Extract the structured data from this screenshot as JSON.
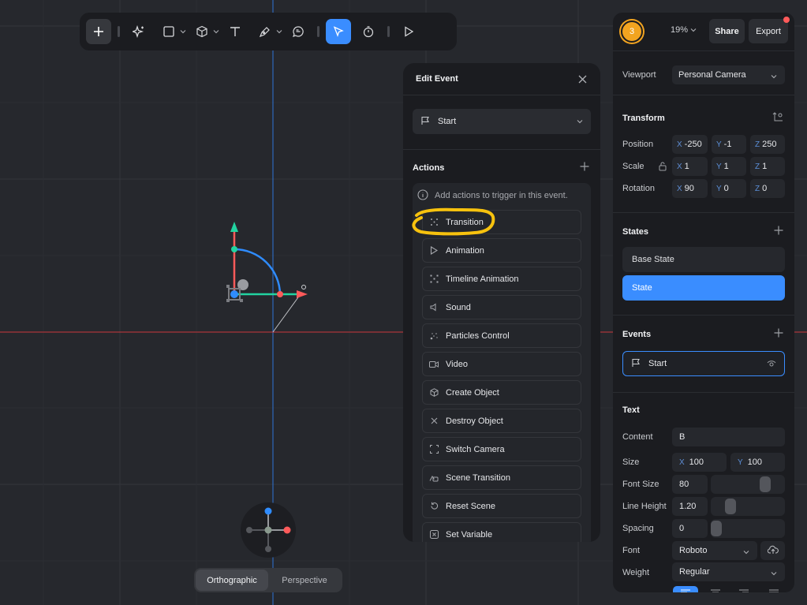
{
  "toolbar": {
    "tools": [
      "add",
      "ai-sparkle",
      "rectangle",
      "cube",
      "text",
      "pen",
      "comment",
      "select",
      "animate",
      "play"
    ]
  },
  "edit_event": {
    "title": "Edit Event",
    "event_select": "Start",
    "actions_title": "Actions",
    "hint": "Add actions to trigger in this event.",
    "actions": [
      {
        "label": "Transition",
        "icon": "transition-icon"
      },
      {
        "label": "Animation",
        "icon": "play-outline-icon"
      },
      {
        "label": "Timeline Animation",
        "icon": "timeline-icon"
      },
      {
        "label": "Sound",
        "icon": "speaker-icon"
      },
      {
        "label": "Particles Control",
        "icon": "particles-icon"
      },
      {
        "label": "Video",
        "icon": "video-icon"
      },
      {
        "label": "Create Object",
        "icon": "cube-icon"
      },
      {
        "label": "Destroy Object",
        "icon": "x-icon"
      },
      {
        "label": "Switch Camera",
        "icon": "camera-frame-icon"
      },
      {
        "label": "Scene Transition",
        "icon": "scene-icon"
      },
      {
        "label": "Reset Scene",
        "icon": "reset-icon"
      },
      {
        "label": "Set Variable",
        "icon": "variable-icon"
      }
    ]
  },
  "header": {
    "avatar_initial": "3",
    "zoom": "19%",
    "share_label": "Share",
    "export_label": "Export"
  },
  "viewport": {
    "label": "Viewport",
    "value": "Personal Camera"
  },
  "transform": {
    "title": "Transform",
    "position_label": "Position",
    "scale_label": "Scale",
    "rotation_label": "Rotation",
    "position": {
      "x": "-250",
      "y": "-1",
      "z": "250"
    },
    "scale": {
      "x": "1",
      "y": "1",
      "z": "1"
    },
    "rotation": {
      "x": "90",
      "y": "0",
      "z": "0"
    }
  },
  "states": {
    "title": "States",
    "items": [
      "Base State",
      "State"
    ]
  },
  "events": {
    "title": "Events",
    "items": [
      "Start"
    ]
  },
  "text": {
    "title": "Text",
    "content_label": "Content",
    "content_value": "B",
    "size_label": "Size",
    "size_x": "100",
    "size_y": "100",
    "font_size_label": "Font Size",
    "font_size_value": "80",
    "line_height_label": "Line Height",
    "line_height_value": "1.20",
    "spacing_label": "Spacing",
    "spacing_value": "0",
    "font_label": "Font",
    "font_value": "Roboto",
    "weight_label": "Weight",
    "weight_value": "Regular"
  },
  "view_toggle": {
    "orthographic": "Orthographic",
    "perspective": "Perspective"
  },
  "colors": {
    "accent": "#3a8dff",
    "highlight": "#f7c20e",
    "axis_red": "#ff4d4d",
    "axis_green": "#22d3a0"
  }
}
